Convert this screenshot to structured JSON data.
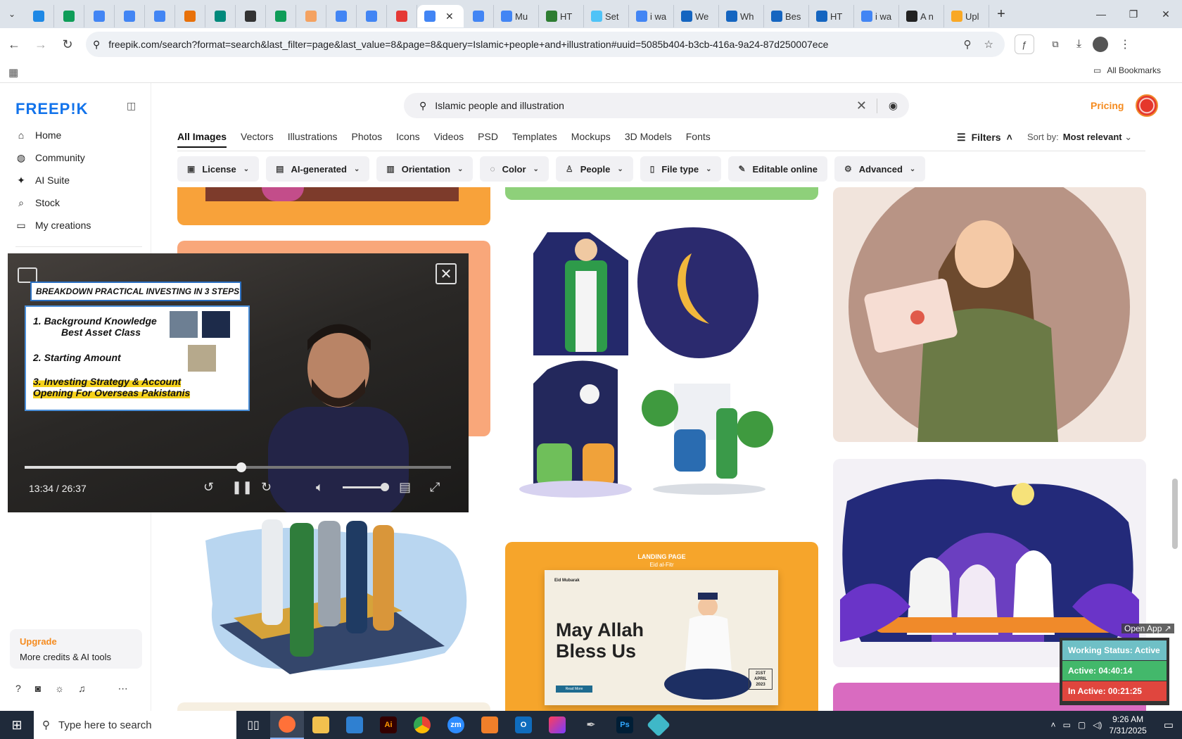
{
  "browser": {
    "tabs": [
      {
        "label": "",
        "color": "#1e88e5"
      },
      {
        "label": "",
        "color": "#0f9d58"
      },
      {
        "label": "",
        "color": "#4285f4"
      },
      {
        "label": "",
        "color": "#4285f4"
      },
      {
        "label": "",
        "color": "#4285f4"
      },
      {
        "label": "",
        "color": "#e8710a"
      },
      {
        "label": "",
        "color": "#00897b"
      },
      {
        "label": "",
        "color": "#333333"
      },
      {
        "label": "",
        "color": "#0f9d58"
      },
      {
        "label": "",
        "color": "#f4a261"
      },
      {
        "label": "",
        "color": "#4285f4"
      },
      {
        "label": "",
        "color": "#4285f4"
      },
      {
        "label": "",
        "color": "#e53935"
      },
      {
        "label": "",
        "color": "#4285f4"
      },
      {
        "label": "",
        "color": "#4285f4"
      },
      {
        "label": "Mu",
        "color": "#4285f4"
      },
      {
        "label": "HT",
        "color": "#2e7d32"
      },
      {
        "label": "Set",
        "color": "#4fc3f7"
      },
      {
        "label": "i wa",
        "color": "#4285f4"
      },
      {
        "label": "We",
        "color": "#1565c0"
      },
      {
        "label": "Wh",
        "color": "#1565c0"
      },
      {
        "label": "Bes",
        "color": "#1565c0"
      },
      {
        "label": "HT",
        "color": "#1565c0"
      },
      {
        "label": "i wa",
        "color": "#4285f4"
      },
      {
        "label": "A n",
        "color": "#222222"
      },
      {
        "label": "Upl",
        "color": "#f9a825"
      }
    ],
    "new_tab": "+",
    "url": "freepik.com/search?format=search&last_filter=page&last_value=8&page=8&query=Islamic+people+and+illustration#uuid=5085b404-b3cb-416a-9a24-87d250007ece",
    "all_bookmarks": "All Bookmarks"
  },
  "sidebar": {
    "logo": "FREEP!K",
    "items": [
      {
        "label": "Home",
        "icon": "home-icon",
        "glyph": "⌂"
      },
      {
        "label": "Community",
        "icon": "globe-icon",
        "glyph": "◍"
      },
      {
        "label": "AI Suite",
        "icon": "sparkle-icon",
        "glyph": "✦"
      },
      {
        "label": "Stock",
        "icon": "search-icon",
        "glyph": "⌕"
      },
      {
        "label": "My creations",
        "icon": "folder-icon",
        "glyph": "▭"
      }
    ],
    "upgrade_title": "Upgrade",
    "upgrade_sub": "More credits & AI tools"
  },
  "search": {
    "query": "Islamic people and illustration"
  },
  "header": {
    "pricing": "Pricing"
  },
  "categories": [
    "All Images",
    "Vectors",
    "Illustrations",
    "Photos",
    "Icons",
    "Videos",
    "PSD",
    "Templates",
    "Mockups",
    "3D Models",
    "Fonts"
  ],
  "filters": {
    "label": "Filters",
    "sort_label": "Sort by:",
    "sort_value": "Most relevant"
  },
  "chips": [
    {
      "label": "License",
      "icon": "▣"
    },
    {
      "label": "AI-generated",
      "icon": "▤"
    },
    {
      "label": "Orientation",
      "icon": "▥"
    },
    {
      "label": "Color",
      "icon": "◌"
    },
    {
      "label": "People",
      "icon": "♙"
    },
    {
      "label": "File type",
      "icon": "▯"
    },
    {
      "label": "Editable online",
      "icon": "✎"
    },
    {
      "label": "Advanced",
      "icon": "⚙"
    }
  ],
  "landing": {
    "tag": "LANDING PAGE",
    "sub": "Eid al-Fitr",
    "brand": "Eid Mubarak",
    "title1": "May Allah",
    "title2": "Bless Us",
    "date1": "21ST",
    "date2": "APRIL",
    "date3": "2023",
    "button": "Read More"
  },
  "video": {
    "slide_title": "BREAKDOWN PRACTICAL INVESTING IN 3 STEPS",
    "line1a": "1. Background Knowledge",
    "line1b": "Best Asset Class",
    "line2": "2. Starting Amount",
    "line3a": "3. Investing Strategy & Account",
    "line3b": "Opening For Overseas Pakistanis",
    "time": "13:34 / 26:37",
    "progress": 0.509
  },
  "status": {
    "open_app": "Open App ↗",
    "working": "Working Status: Active",
    "active": "Active: 04:40:14",
    "inactive": "In Active: 00:21:25"
  },
  "taskbar": {
    "search_placeholder": "Type here to search",
    "time": "9:26 AM",
    "date": "7/31/2025"
  }
}
